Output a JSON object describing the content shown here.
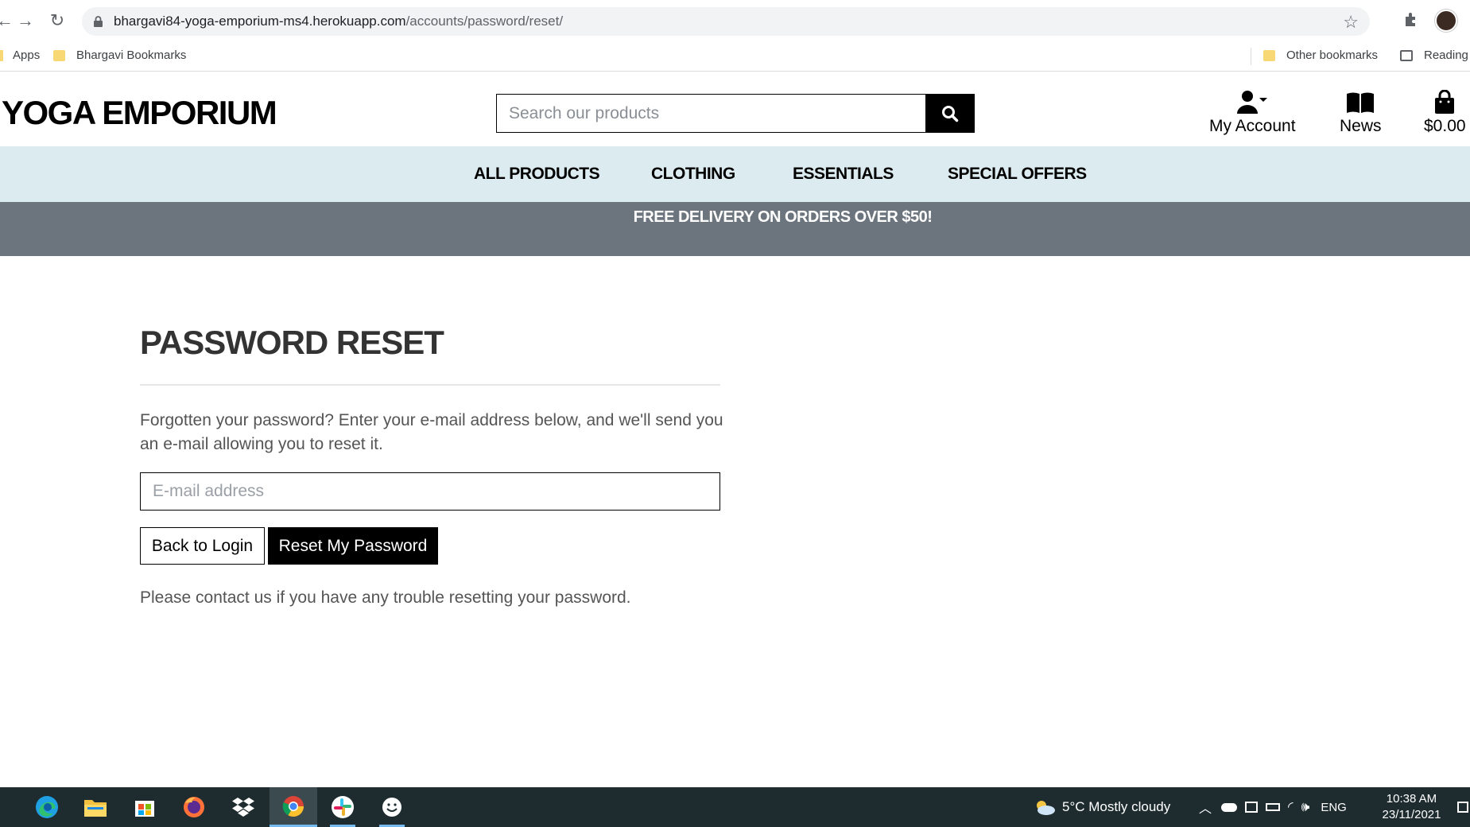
{
  "browser": {
    "url_host": "bhargavi84-yoga-emporium-ms4.herokuapp.com",
    "url_path": "/accounts/password/reset/",
    "bookmarks": [
      {
        "label": "Apps",
        "icon": "apps-grid-icon"
      },
      {
        "label": "Bhargavi Bookmarks",
        "icon": "folder-icon"
      }
    ],
    "other_bookmarks": "Other bookmarks",
    "reading_list": "Reading"
  },
  "header": {
    "logo": "YOGA EMPORIUM",
    "search_placeholder": "Search our products",
    "links": [
      {
        "label": "My Account",
        "icon": "user-dropdown-icon"
      },
      {
        "label": "News",
        "icon": "book-icon"
      },
      {
        "label": "$0.00",
        "icon": "shopping-bag-icon"
      }
    ]
  },
  "nav": {
    "items": [
      "ALL PRODUCTS",
      "CLOTHING",
      "ESSENTIALS",
      "SPECIAL OFFERS"
    ]
  },
  "promo": "FREE DELIVERY ON ORDERS OVER $50!",
  "main": {
    "title": "PASSWORD RESET",
    "intro": "Forgotten your password? Enter your e-mail address below, and we'll send you an e-mail allowing you to reset it.",
    "email_placeholder": "E-mail address",
    "back_button": "Back to Login",
    "reset_button": "Reset My Password",
    "help_text": "Please contact us if you have any trouble resetting your password."
  },
  "taskbar": {
    "weather": "5°C  Mostly cloudy",
    "language": "ENG",
    "time": "10:38 AM",
    "date": "23/11/2021"
  },
  "colors": {
    "nav_bg": "#dcebf0",
    "promo_bg": "#6c757d",
    "taskbar_bg": "#1e2c30"
  }
}
